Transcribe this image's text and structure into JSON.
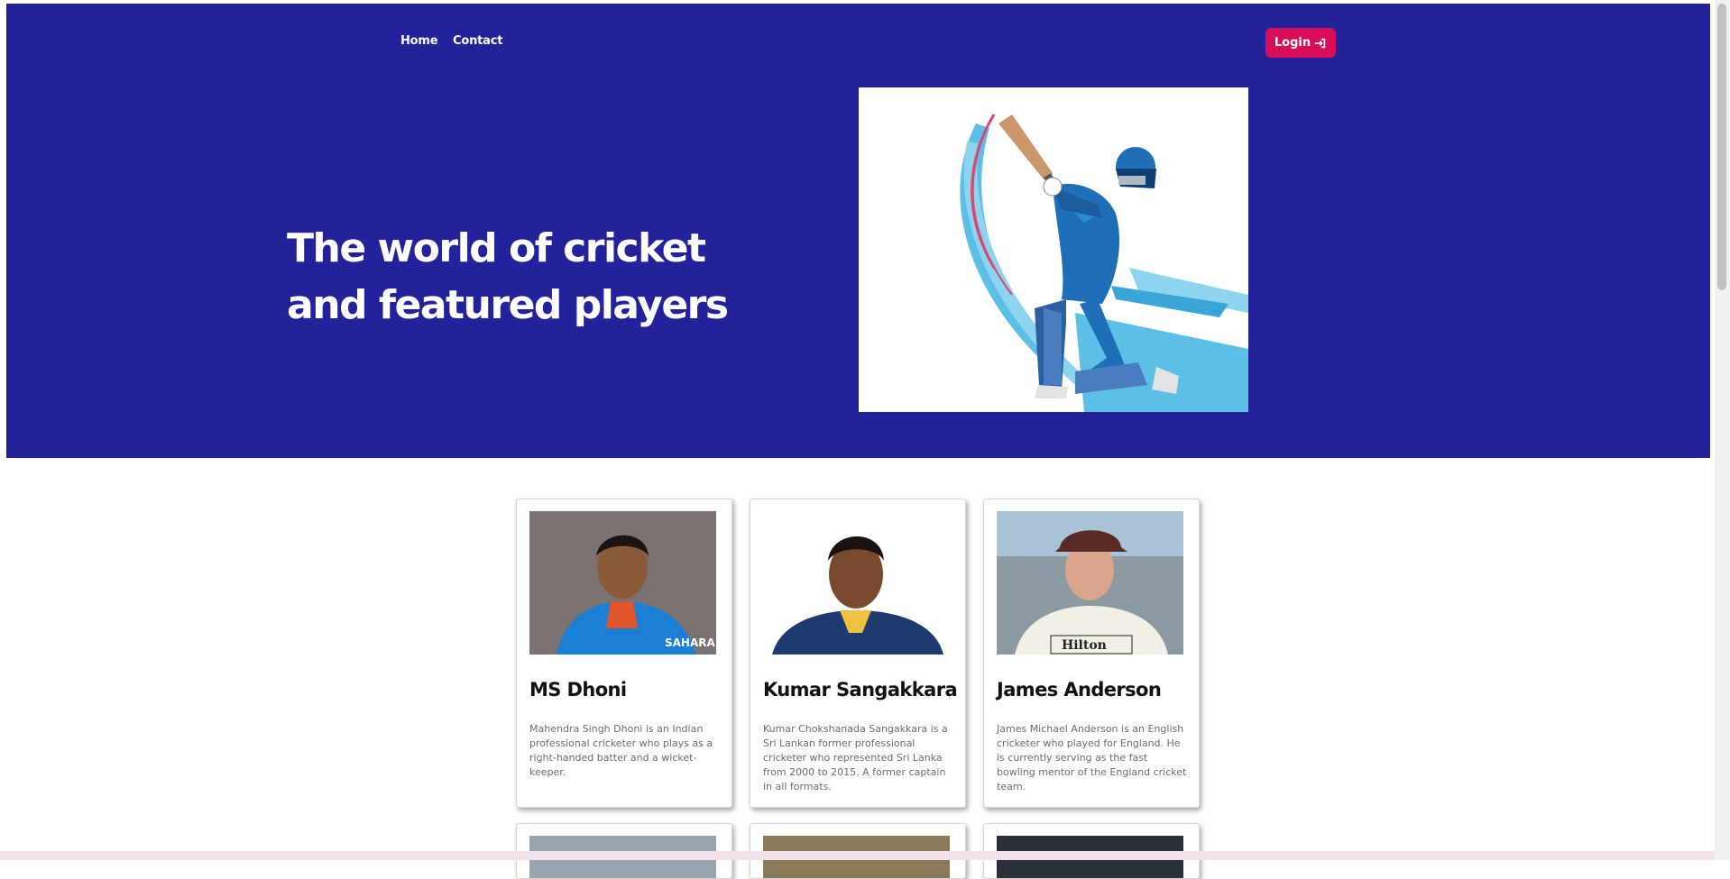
{
  "nav": {
    "home_label": "Home",
    "contact_label": "Contact",
    "login_label": "Login"
  },
  "hero": {
    "title": "The world of cricket and featured players",
    "background": "#24229b"
  },
  "colors": {
    "accent": "#d90c59",
    "hero_bg": "#24229b"
  },
  "players": [
    {
      "name": "MS Dhoni",
      "description": "Mahendra Singh Dhoni is an Indian professional cricketer who plays as a right-handed batter and a wicket-keeper."
    },
    {
      "name": "Kumar Sangakkara",
      "description": "Kumar Chokshanada Sangakkara is a Sri Lankan former professional cricketer who represented Sri Lanka from 2000 to 2015. A former captain in all formats."
    },
    {
      "name": "James Anderson",
      "description": "James Michael Anderson is an English cricketer who played for England. He is currently serving as the fast bowling mentor of the England cricket team."
    }
  ]
}
